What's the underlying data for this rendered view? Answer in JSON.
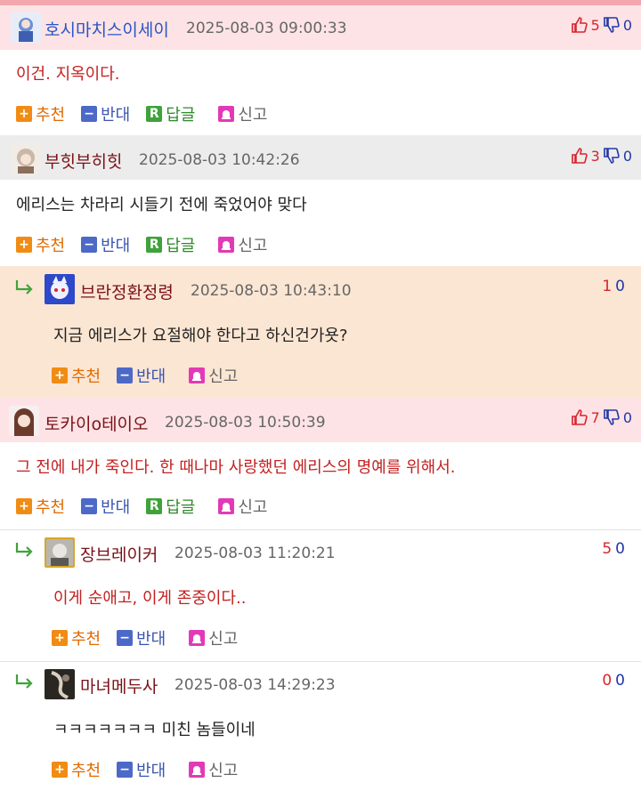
{
  "labels": {
    "recommend": "추천",
    "oppose": "반대",
    "reply": "답글",
    "report": "신고"
  },
  "colors": {
    "top_bar": "#f3a6ad",
    "header_pink": "#fde3e5",
    "header_gray": "#ececec",
    "reply_highlight": "#fbe6d3",
    "upvote": "#d8242d",
    "downvote": "#2236a8"
  },
  "comments": [
    {
      "nickname": "호시마치스이세이",
      "time": "2025-08-03 09:00:33",
      "up": "5",
      "down": "0",
      "text": "이건. 지옥이다."
    },
    {
      "nickname": "부힛부히힛",
      "time": "2025-08-03 10:42:26",
      "up": "3",
      "down": "0",
      "text": "에리스는 차라리 시들기 전에 죽었어야 맞다"
    },
    {
      "nickname": "브란정환정령",
      "time": "2025-08-03 10:43:10",
      "up": "1",
      "down": "0",
      "text": "지금 에리스가 요절해야 한다고 하신건가욧?"
    },
    {
      "nickname": "토카이o테이오",
      "time": "2025-08-03 10:50:39",
      "up": "7",
      "down": "0",
      "text": "그 전에 내가 죽인다. 한 때나마 사랑했던 에리스의 명예를 위해서."
    },
    {
      "nickname": "장브레이커",
      "time": "2025-08-03 11:20:21",
      "up": "5",
      "down": "0",
      "text": "이게 순애고, 이게 존중이다.."
    },
    {
      "nickname": "마녀메두사",
      "time": "2025-08-03 14:29:23",
      "up": "0",
      "down": "0",
      "text": "ㅋㅋㅋㅋㅋㅋㅋ 미친 놈들이네"
    }
  ]
}
